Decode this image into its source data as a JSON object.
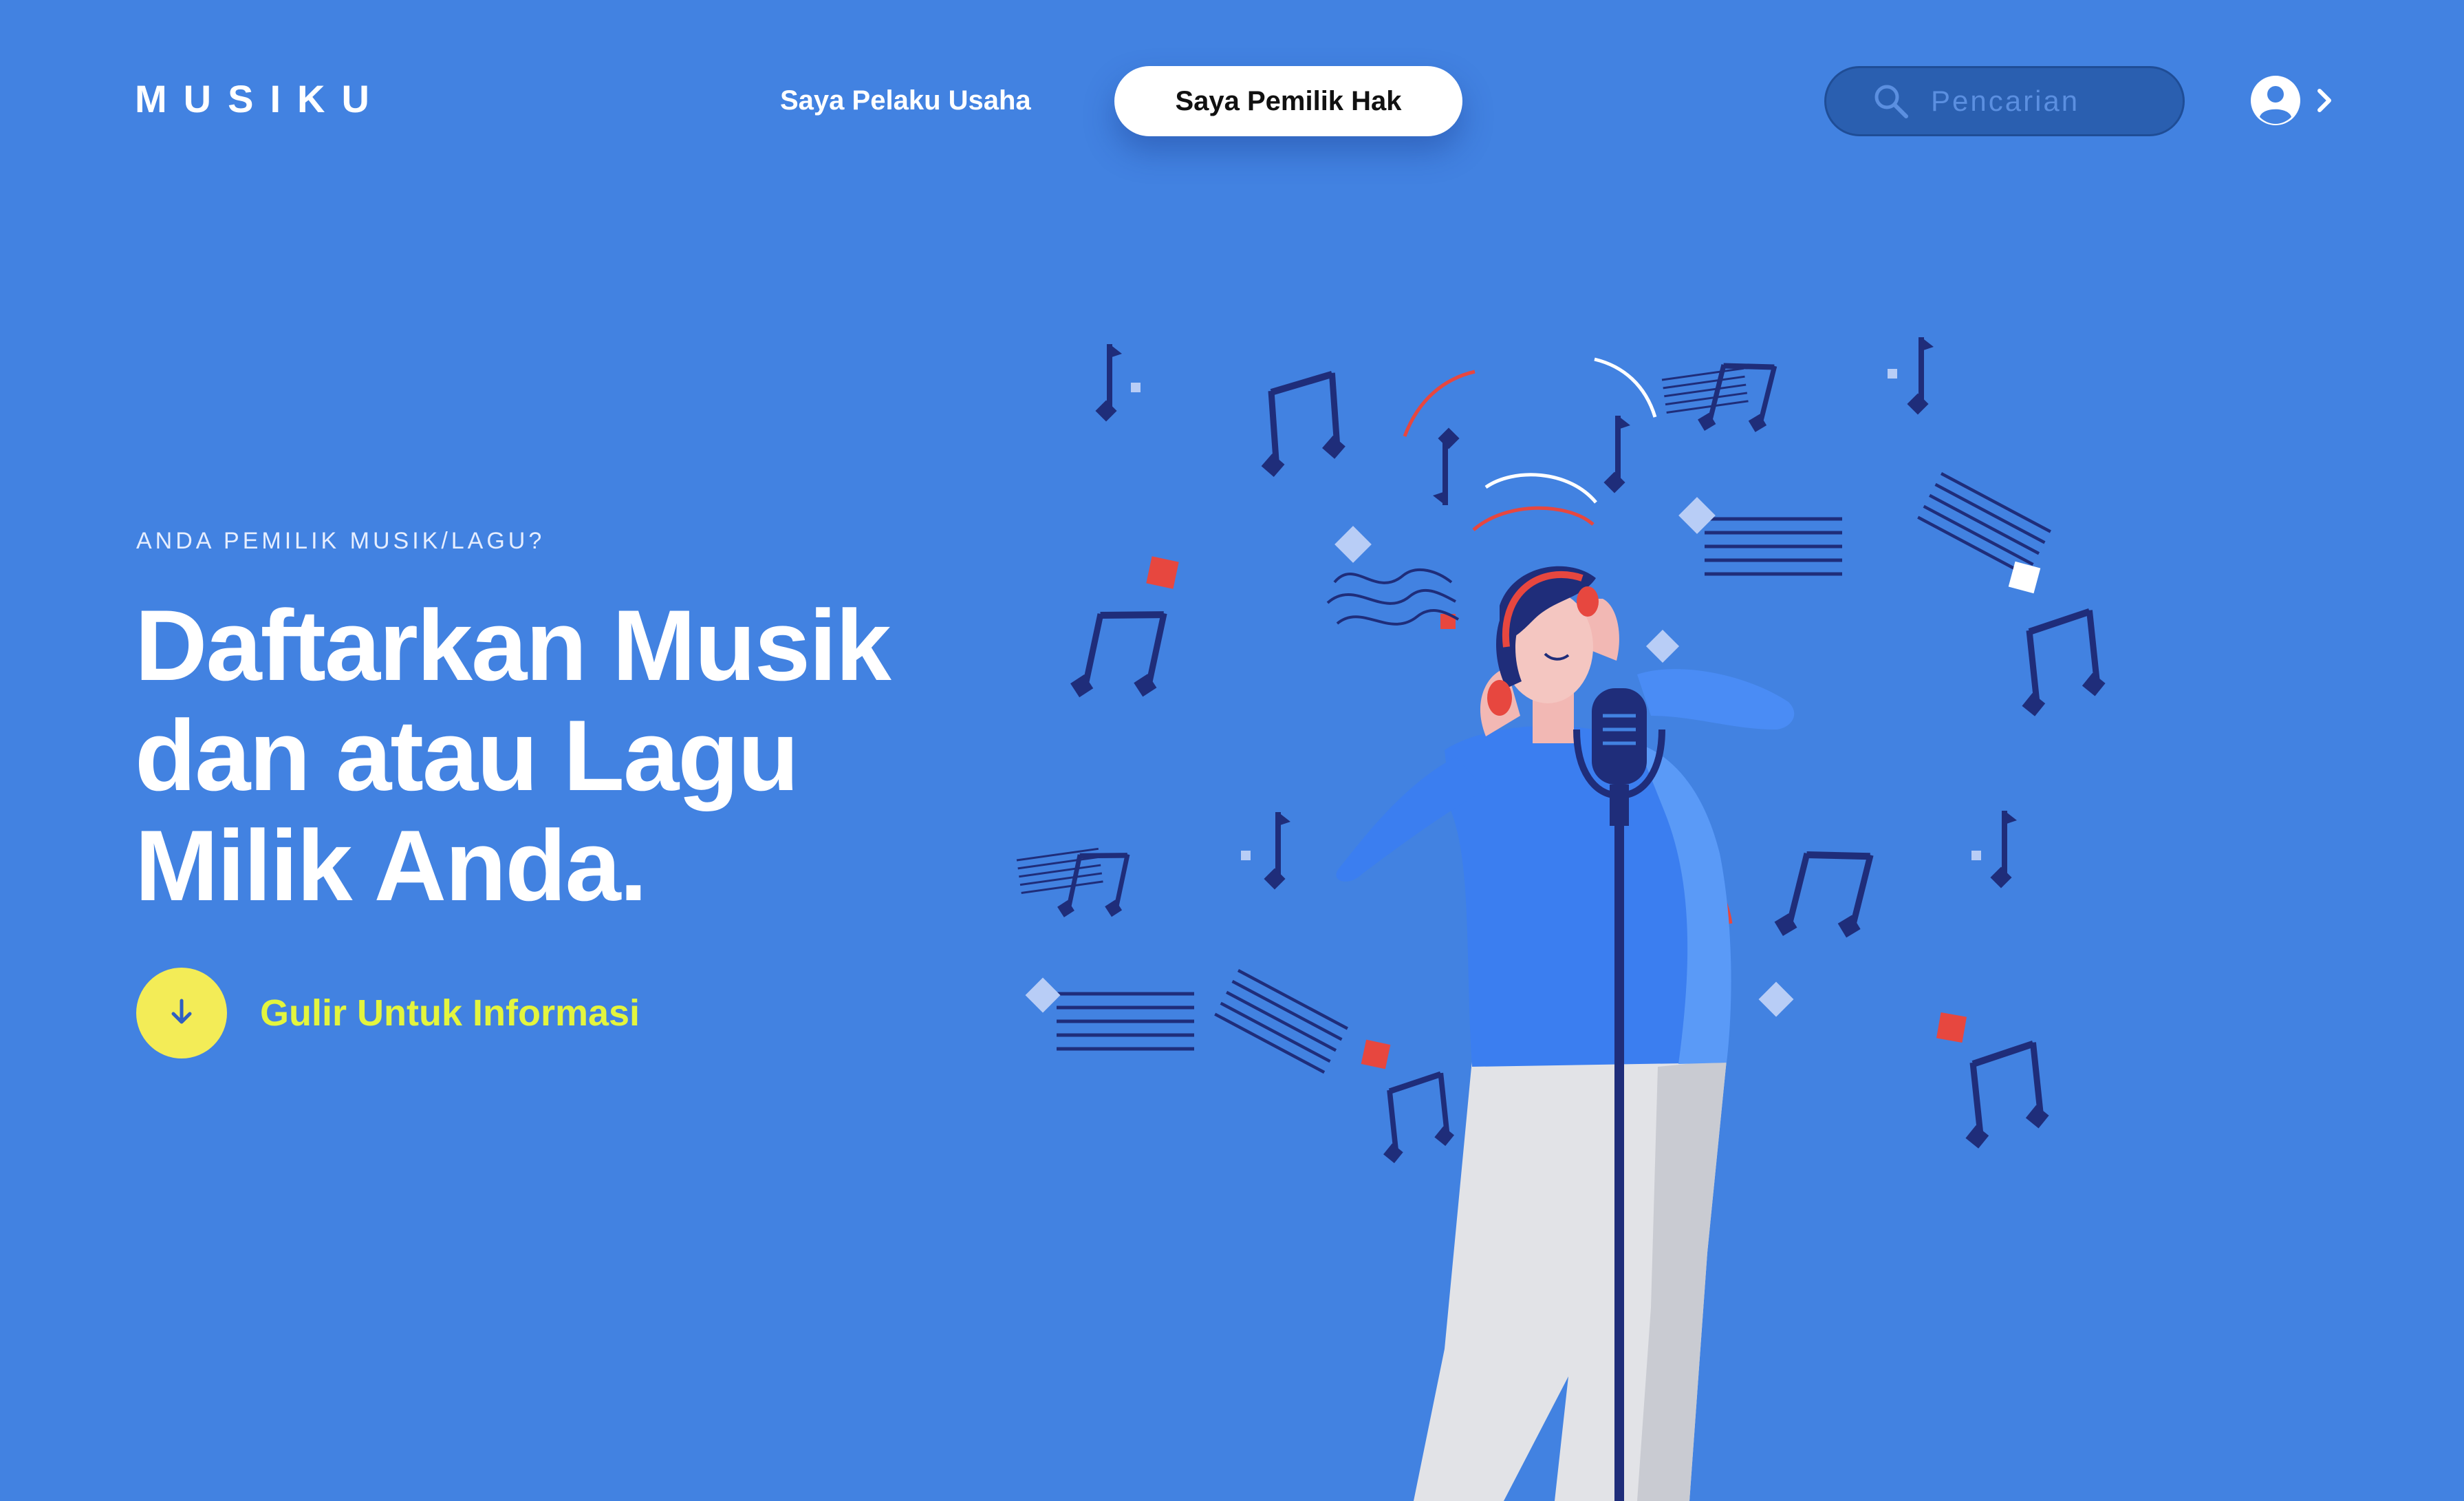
{
  "header": {
    "logo": "MUSIKU",
    "nav": {
      "business_label": "Saya Pelaku Usaha",
      "owner_label": "Saya Pemilik Hak"
    },
    "search": {
      "placeholder": "Pencarian",
      "value": ""
    }
  },
  "hero": {
    "kicker": "ANDA PEMILIK MUSIK/LAGU?",
    "headline_line1": "Daftarkan Musik",
    "headline_line2": "dan atau Lagu",
    "headline_line3": "Milik Anda.",
    "cta_label": "Gulir Untuk Informasi"
  },
  "icons": {
    "search": "search-icon",
    "account": "user-circle-icon",
    "account_chevron": "chevron-right-icon",
    "scroll": "arrow-down-icon"
  },
  "colors": {
    "background": "#4282e1",
    "search_bg": "#2a5fb0",
    "cta_circle": "#f3ec57",
    "cta_text": "#e3f53e",
    "accent_red": "#e7473f",
    "note_navy": "#1f2d7a"
  }
}
